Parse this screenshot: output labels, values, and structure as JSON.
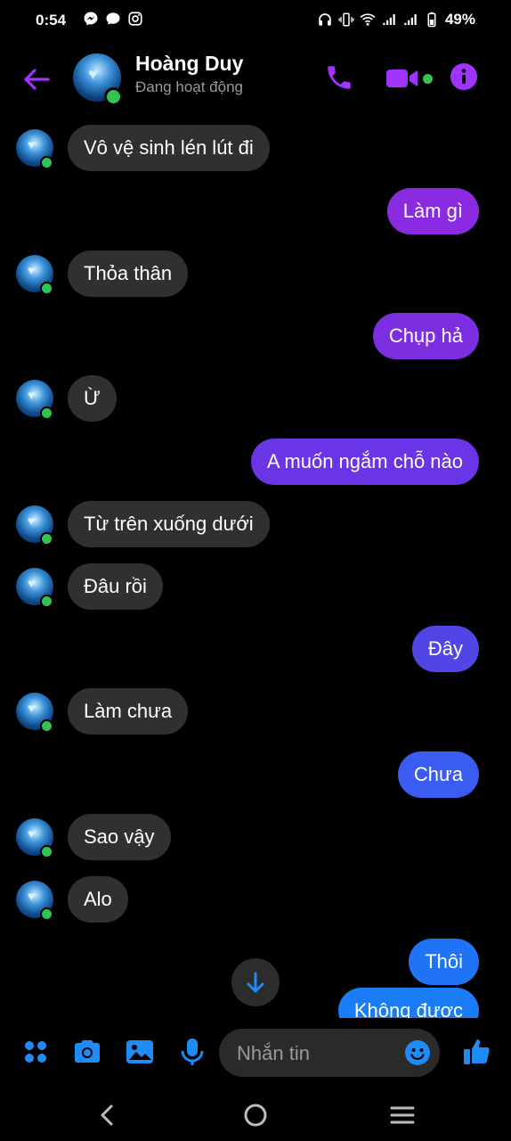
{
  "status_bar": {
    "time": "0:54",
    "battery": "49%"
  },
  "header": {
    "name": "Hoàng Duy",
    "status": "Đang hoạt động"
  },
  "messages": [
    {
      "side": "recv",
      "text": "Vô vệ sinh lén lút đi"
    },
    {
      "side": "sent",
      "text": "Làm gì",
      "color": "#8a2be2"
    },
    {
      "side": "recv",
      "text": "Thỏa thân"
    },
    {
      "side": "sent",
      "text": "Chụp hả",
      "color": "#7b2fe0"
    },
    {
      "side": "recv",
      "text": "Ừ"
    },
    {
      "side": "sent",
      "text": "A muốn ngắm chỗ nào",
      "color": "#6a35e6"
    },
    {
      "side": "recv",
      "text": "Từ trên xuống dưới"
    },
    {
      "side": "recv",
      "text": "Đâu rồi"
    },
    {
      "side": "sent",
      "text": "Đây",
      "color": "#4f46e5"
    },
    {
      "side": "recv",
      "text": "Làm chưa"
    },
    {
      "side": "sent",
      "text": "Chưa",
      "color": "#3a5cf0"
    },
    {
      "side": "recv",
      "text": "Sao vậy"
    },
    {
      "side": "recv",
      "text": "Alo"
    },
    {
      "side": "sent",
      "text": "Thôi",
      "color": "#1e74f5"
    },
    {
      "side": "sent",
      "text": "Không được",
      "color": "#1a7cf6"
    }
  ],
  "composer": {
    "placeholder": "Nhắn tin"
  },
  "colors": {
    "accent": "#a033ff",
    "composer_icons": "#1f8bf5",
    "online": "#31c453"
  }
}
